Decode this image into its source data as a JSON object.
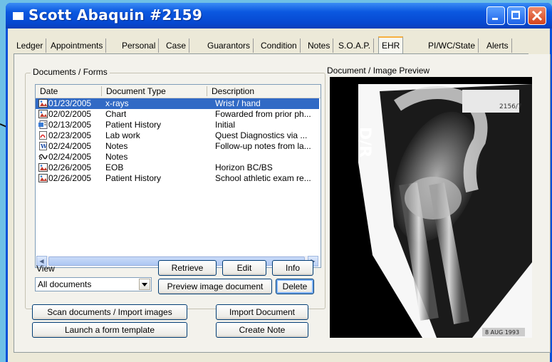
{
  "window": {
    "title": "Scott Abaquin #2159"
  },
  "tabs": [
    {
      "label": "Ledger"
    },
    {
      "label": "Appointments"
    },
    {
      "label": "Personal"
    },
    {
      "label": "Case"
    },
    {
      "label": "Guarantors"
    },
    {
      "label": "Condition"
    },
    {
      "label": "Notes"
    },
    {
      "label": "S.O.A.P."
    },
    {
      "label": "EHR"
    },
    {
      "label": "PI/WC/State"
    },
    {
      "label": "Alerts"
    }
  ],
  "documents": {
    "group_label": "Documents / Forms",
    "columns": {
      "date": "Date",
      "type": "Document Type",
      "description": "Description"
    },
    "rows": [
      {
        "icon": "image-icon",
        "date": "01/23/2005",
        "type": "x-rays",
        "description": "Wrist / hand",
        "selected": true
      },
      {
        "icon": "image-icon",
        "date": "02/02/2005",
        "type": "Chart",
        "description": "Fowarded from prior ph..."
      },
      {
        "icon": "form-icon",
        "date": "02/13/2005",
        "type": "Patient History",
        "description": "Initial"
      },
      {
        "icon": "pdf-icon",
        "date": "02/23/2005",
        "type": "Lab work",
        "description": "Quest Diagnostics via ..."
      },
      {
        "icon": "word-icon",
        "date": "02/24/2005",
        "type": "Notes",
        "description": "Follow-up notes from la..."
      },
      {
        "icon": "note-icon",
        "date": "02/24/2005",
        "type": "Notes",
        "description": ""
      },
      {
        "icon": "image-icon",
        "date": "02/26/2005",
        "type": "EOB",
        "description": "Horizon BC/BS"
      },
      {
        "icon": "image-icon",
        "date": "02/26/2005",
        "type": "Patient History",
        "description": "School athletic exam re..."
      }
    ]
  },
  "view": {
    "label": "View",
    "selected": "All documents"
  },
  "buttons": {
    "retrieve": "Retrieve",
    "edit": "Edit",
    "info": "Info",
    "preview": "Preview image document",
    "delete": "Delete",
    "scan": "Scan documents / Import images",
    "launch": "Launch a form template",
    "import": "Import Document",
    "create_note": "Create Note"
  },
  "preview": {
    "label": "Document / Image Preview",
    "xray_marker": "D/R",
    "xray_stamp": "8 AUG 1993",
    "xray_tag_text": "2156/7"
  }
}
